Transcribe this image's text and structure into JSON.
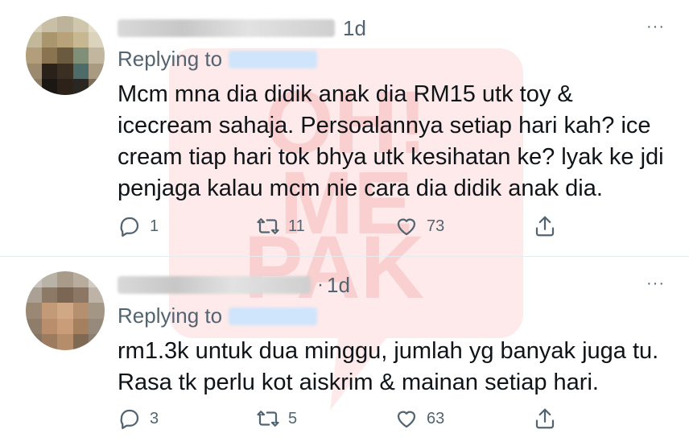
{
  "watermark": {
    "lines": [
      "OH!",
      "ME",
      "PAK"
    ],
    "color": "#f7a6a6"
  },
  "tweets": [
    {
      "time": "1d",
      "time_sep": "",
      "reply_label": "Replying to",
      "more": "···",
      "text": "Mcm mna dia didik anak dia RM15 utk toy & icecream sahaja. Persoalannya setiap hari kah? ice cream tiap hari tok bhya utk kesihatan ke? lyak ke jdi penjaga kalau mcm nie cara dia didik anak dia.",
      "replies": "1",
      "retweets": "11",
      "likes": "73"
    },
    {
      "time": "1d",
      "time_sep": "·",
      "reply_label": "Replying to",
      "more": "···",
      "text": "rm1.3k untuk dua minggu, jumlah yg banyak juga tu. Rasa tk perlu kot aiskrim & mainan setiap hari.",
      "replies": "3",
      "retweets": "5",
      "likes": "63"
    }
  ],
  "icons": {
    "reply": "reply-icon",
    "retweet": "retweet-icon",
    "like": "heart-icon",
    "share": "share-icon",
    "more": "more-icon"
  },
  "colors": {
    "icon": "#536471",
    "text": "#0f1419",
    "divider": "#e6ecf0"
  }
}
